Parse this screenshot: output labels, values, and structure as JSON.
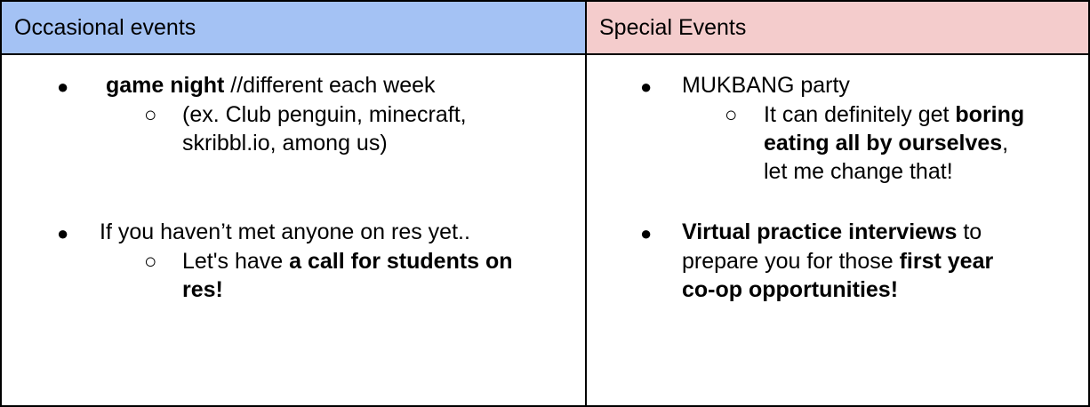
{
  "headers": {
    "left": "Occasional events",
    "right": "Special Events"
  },
  "bullets": {
    "main": "●",
    "sub": "○"
  },
  "left": {
    "item1": {
      "bold": "game night",
      "rest": " //different each week",
      "sub_line1": "(ex. Club penguin, minecraft,",
      "sub_line2": "skribbl.io, among us)"
    },
    "item2": {
      "text": "If you haven’t met anyone on res yet..",
      "sub_plain": "Let's have ",
      "sub_bold_a": "a call for students on",
      "sub_bold_b": "res!"
    }
  },
  "right": {
    "item1": {
      "text": "MUKBANG  party",
      "sub_plain1": "It can definitely get ",
      "sub_bold1": "boring",
      "sub_bold2": "eating all by ourselves",
      "sub_comma": ",",
      "sub_line3": "let me change that!"
    },
    "item2": {
      "bold1": "Virtual practice interviews",
      "plain1": " to",
      "plain2": "prepare you for those ",
      "bold2": "first year",
      "bold3": "co-op opportunities!"
    }
  }
}
